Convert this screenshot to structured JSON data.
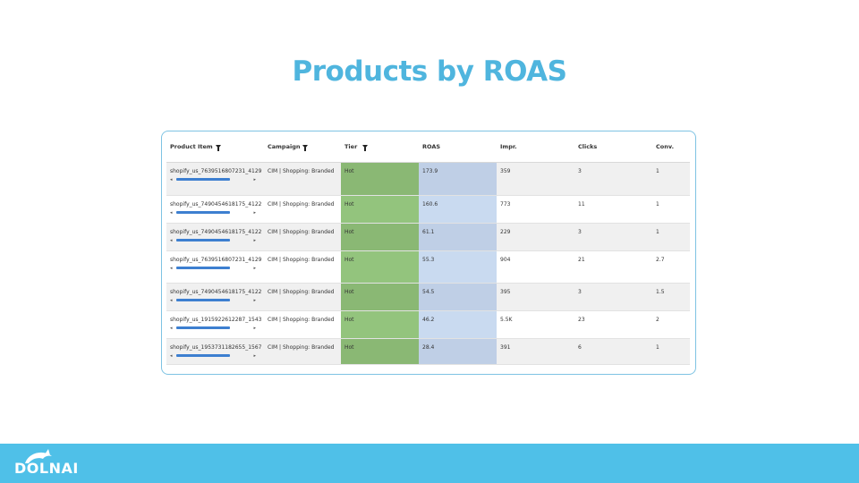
{
  "title": "Products by ROAS",
  "colors": {
    "title": "#4fb5de",
    "footer": "#4fc0e8",
    "tier_hot": "#93c47d",
    "roas_fill": "#c9daf0",
    "scroll_thumb": "#3d7fd0"
  },
  "table": {
    "headers": [
      "Product Item",
      "Campaign",
      "Tier",
      "ROAS",
      "Impr.",
      "Clicks",
      "Conv."
    ],
    "filtered_columns": [
      "Product Item",
      "Campaign",
      "Tier"
    ],
    "rows": [
      {
        "product": "shopify_us_7639516807231_4129",
        "campaign": "CIM | Shopping: Branded",
        "tier": "Hot",
        "roas": "173.9",
        "impr": "359",
        "clicks": "3",
        "conv": "1"
      },
      {
        "product": "shopify_us_7490454618175_4122",
        "campaign": "CIM | Shopping: Branded",
        "tier": "Hot",
        "roas": "160.6",
        "impr": "773",
        "clicks": "11",
        "conv": "1"
      },
      {
        "product": "shopify_us_7490454618175_4122",
        "campaign": "CIM | Shopping: Branded",
        "tier": "Hot",
        "roas": "61.1",
        "impr": "229",
        "clicks": "3",
        "conv": "1"
      },
      {
        "product": "shopify_us_7639516807231_4129",
        "campaign": "CIM | Shopping: Branded",
        "tier": "Hot",
        "roas": "55.3",
        "impr": "904",
        "clicks": "21",
        "conv": "2.7"
      },
      {
        "product": "shopify_us_7490454618175_4122",
        "campaign": "CIM | Shopping: Branded",
        "tier": "Hot",
        "roas": "54.5",
        "impr": "395",
        "clicks": "3",
        "conv": "1.5"
      },
      {
        "product": "shopify_us_1915922612287_1543",
        "campaign": "CIM | Shopping: Branded",
        "tier": "Hot",
        "roas": "46.2",
        "impr": "5.5K",
        "clicks": "23",
        "conv": "2"
      },
      {
        "product": "shopify_us_1953731182655_1567",
        "campaign": "CIM | Shopping: Branded",
        "tier": "Hot",
        "roas": "28.4",
        "impr": "391",
        "clicks": "6",
        "conv": "1"
      }
    ]
  },
  "footer": {
    "logo_text": "DOLNAI",
    "logo_icon": "dolphin-icon"
  }
}
